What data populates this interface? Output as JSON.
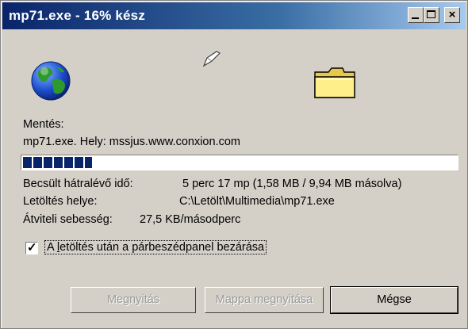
{
  "window": {
    "title": "mp71.exe - 16% kész",
    "controls": [
      "minimize",
      "maximize",
      "close"
    ],
    "close_glyph": "×"
  },
  "icons": {
    "source": "globe-icon",
    "transfer": "paper-icon",
    "destination": "folder-icon"
  },
  "download": {
    "save_label": "Mentés:",
    "file_source": "mp71.exe. Hely: mssjus.www.conxion.com",
    "progress_fraction": 0.16,
    "estimated_label": "Becsült hátralévő idő:",
    "estimated_value": "5 perc 17 mp (1,58 MB / 9,94 MB másolva)",
    "download_to_label": "Letöltés helye:",
    "download_to_value": "C:\\Letölt\\Multimedia\\mp71.exe",
    "rate_label": "Átviteli sebesség:",
    "rate_value": "27,5 KB/másodperc"
  },
  "checkbox": {
    "checked": true,
    "check_glyph": "✓",
    "label_pre": "A ",
    "label_accel": "l",
    "label_post": "etöltés után a párbeszédpanel bezárása"
  },
  "buttons": {
    "open": "Megnyitás",
    "open_folder": "Mappa megnyitása",
    "cancel": "Mégse"
  },
  "colors": {
    "title_start": "#0a246a",
    "title_end": "#a6caf0",
    "face": "#d4d0c8",
    "progress": "#0a246a"
  }
}
